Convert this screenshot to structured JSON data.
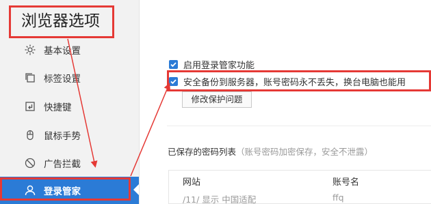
{
  "window": {
    "title": "浏览器选项"
  },
  "sidebar": {
    "items": [
      {
        "label": "基本设置",
        "icon": "gear-icon"
      },
      {
        "label": "标签设置",
        "icon": "tabs-icon"
      },
      {
        "label": "快捷键",
        "icon": "shortcut-icon"
      },
      {
        "label": "鼠标手势",
        "icon": "mouse-icon"
      },
      {
        "label": "广告拦截",
        "icon": "block-icon"
      },
      {
        "label": "登录管家",
        "icon": "user-icon",
        "active": true
      }
    ]
  },
  "main": {
    "options": [
      {
        "label": "启用登录管家功能",
        "checked": true
      },
      {
        "label": "安全备份到服务器，账号密码永不丢失，换台电脑也能用",
        "checked": true
      }
    ],
    "modify_button": "修改保护问题",
    "saved_list": {
      "label": "已保存的密码列表",
      "note": "（账号密码加密保存，安全不泄露）",
      "columns": [
        "网站",
        "账号名"
      ],
      "rows": [
        [
          "/11/  显示  中国适配",
          "ffq"
        ]
      ]
    }
  },
  "colors": {
    "accent": "#2b7bd6",
    "highlight": "#e53935",
    "sidebar_bg": "#f2f2f2"
  }
}
